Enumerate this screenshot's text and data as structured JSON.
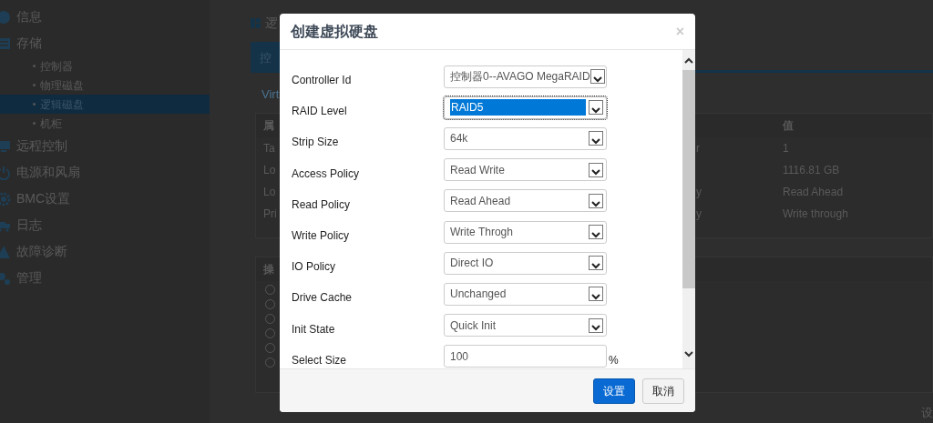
{
  "sidebar": {
    "items": [
      {
        "label": "信息",
        "selected": false
      },
      {
        "label": "存储",
        "selected": false,
        "children": [
          {
            "label": "控制器",
            "selected": false
          },
          {
            "label": "物理磁盘",
            "selected": false
          },
          {
            "label": "逻辑磁盘",
            "selected": true
          },
          {
            "label": "机柜",
            "selected": false
          }
        ]
      },
      {
        "label": "远程控制",
        "selected": false
      },
      {
        "label": "电源和风扇",
        "selected": false
      },
      {
        "label": "BMC设置",
        "selected": false
      },
      {
        "label": "日志",
        "selected": false
      },
      {
        "label": "故障诊断",
        "selected": false
      },
      {
        "label": "管理",
        "selected": false
      }
    ]
  },
  "page": {
    "heading": "逻",
    "tabs": [
      {
        "label": "控",
        "selected": true
      }
    ],
    "link": "Virt",
    "properties_table": {
      "columns": [
        "属",
        "值"
      ],
      "rows": [
        {
          "property": "Ta",
          "column_2": "r",
          "value": "1"
        },
        {
          "property": "Lo",
          "value": "1116.81 GB"
        },
        {
          "property": "Lo",
          "column_2": "y",
          "value": "Read Ahead"
        },
        {
          "property": "Pri",
          "column_2": "y",
          "value": "Write through"
        }
      ]
    },
    "operations": {
      "title": "操",
      "radios": [
        {
          "checked": false
        },
        {
          "checked": false
        },
        {
          "checked": false
        },
        {
          "checked": false
        },
        {
          "checked": false
        },
        {
          "checked": false
        }
      ]
    },
    "footer_button": "设"
  },
  "dialog": {
    "title": "创建虚拟硬盘",
    "close": "×",
    "fields": [
      {
        "kind": "select",
        "label": "Controller Id",
        "value": "控制器0--AVAGO MegaRAID",
        "focused": false
      },
      {
        "kind": "select",
        "label": "RAID Level",
        "value": "RAID5",
        "focused": true
      },
      {
        "kind": "select",
        "label": "Strip Size",
        "value": "64k",
        "focused": false
      },
      {
        "kind": "select",
        "label": "Access Policy",
        "value": "Read Write",
        "focused": false
      },
      {
        "kind": "select",
        "label": "Read Policy",
        "value": "Read Ahead",
        "focused": false
      },
      {
        "kind": "select",
        "label": "Write Policy",
        "value": "Write Throgh",
        "focused": false
      },
      {
        "kind": "select",
        "label": "IO Policy",
        "value": "Direct IO",
        "focused": false
      },
      {
        "kind": "select",
        "label": "Drive Cache",
        "value": "Unchanged",
        "focused": false
      },
      {
        "kind": "select",
        "label": "Init State",
        "value": "Quick Init",
        "focused": false
      },
      {
        "kind": "input",
        "label": "Select Size",
        "value": "100",
        "unit": "%",
        "focused": false
      }
    ],
    "buttons": [
      {
        "label": "设置",
        "kind": "primary"
      },
      {
        "label": "取消",
        "kind": "default"
      }
    ]
  }
}
